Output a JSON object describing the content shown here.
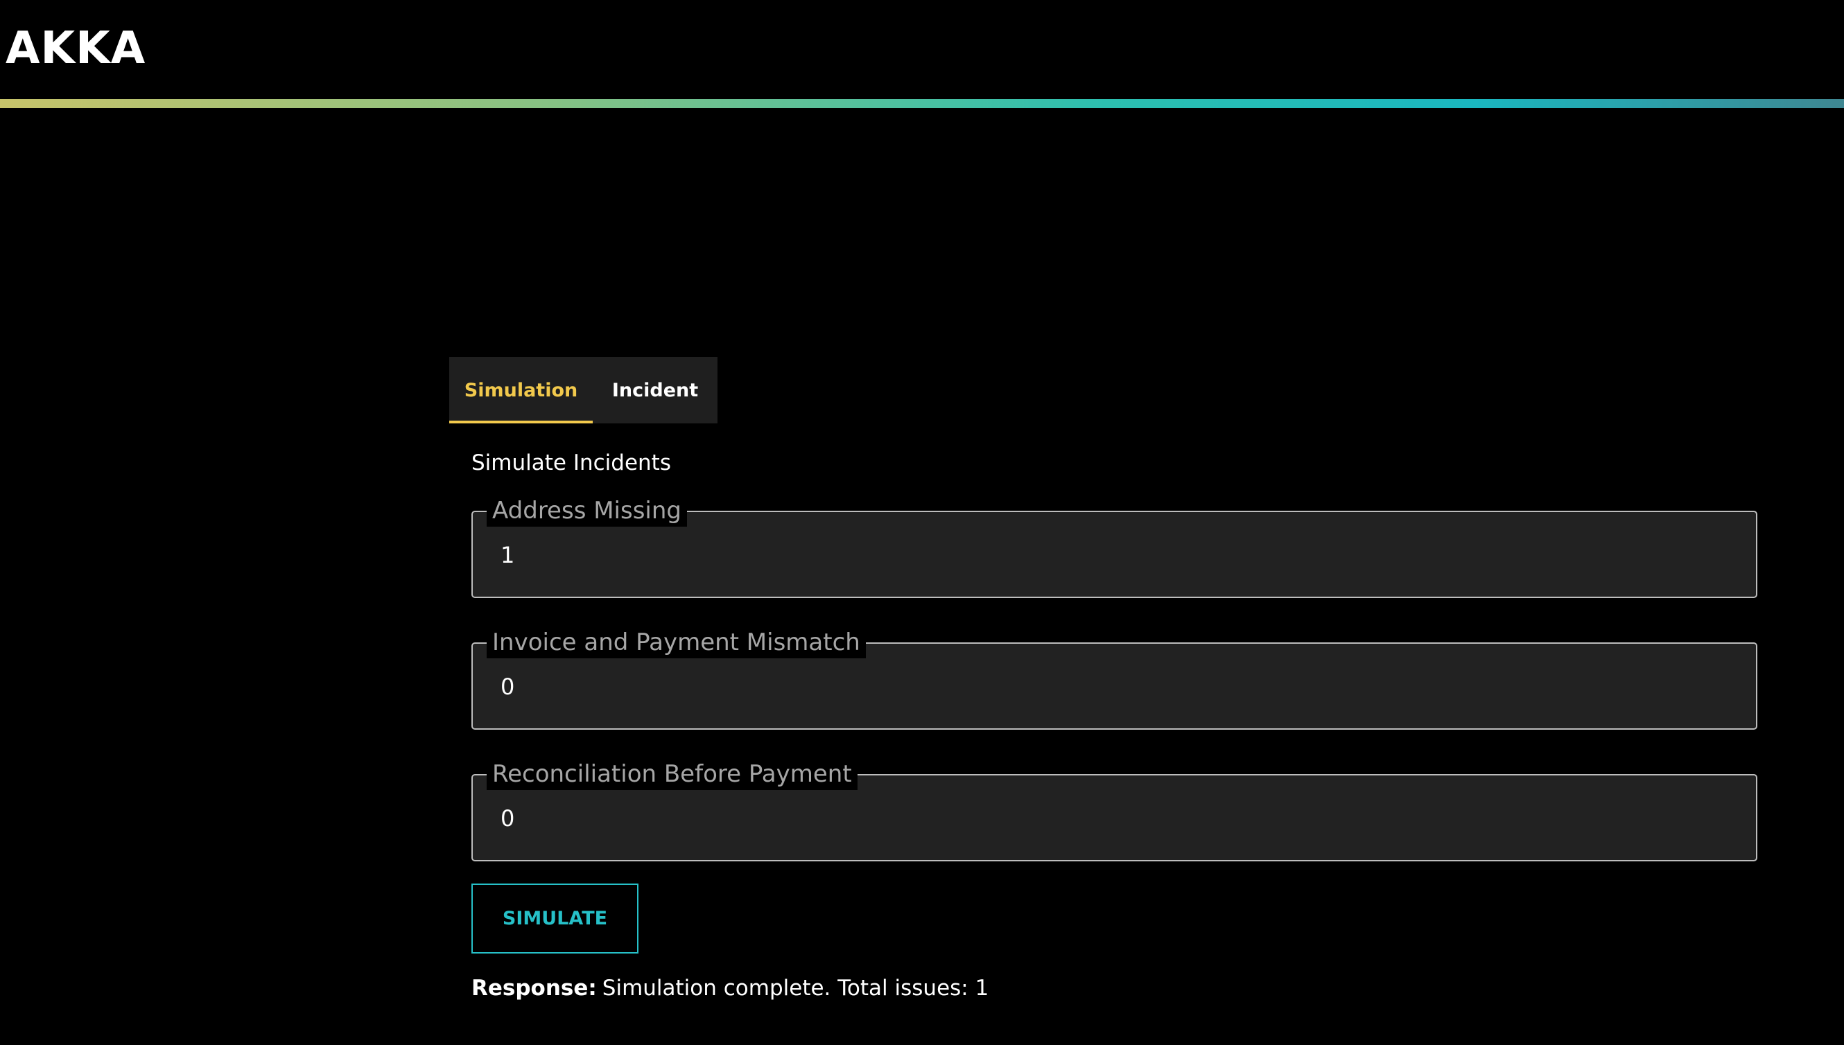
{
  "header": {
    "logo_text": "AKKA"
  },
  "tabs": [
    {
      "label": "Simulation",
      "active": true
    },
    {
      "label": "Incident",
      "active": false
    }
  ],
  "form": {
    "title": "Simulate Incidents",
    "fields": [
      {
        "label": "Address Missing",
        "value": "1"
      },
      {
        "label": "Invoice and Payment Mismatch",
        "value": "0"
      },
      {
        "label": "Reconciliation Before Payment",
        "value": "0"
      }
    ],
    "submit_label": "SIMULATE"
  },
  "response": {
    "label": "Response:",
    "text": "Simulation complete. Total issues: 1"
  },
  "colors": {
    "background": "#000000",
    "active_tab": "#f2c94c",
    "button_accent": "#26c0c8",
    "field_background": "#222222"
  }
}
